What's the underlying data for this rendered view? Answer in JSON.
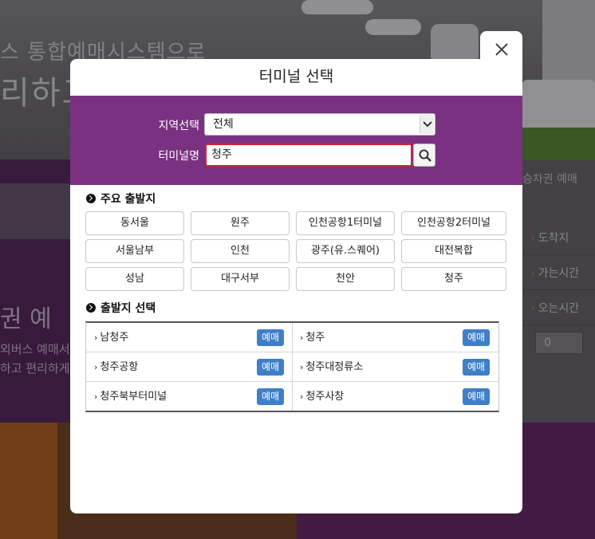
{
  "background": {
    "hero_line1": "스 통합예매시스템으로",
    "hero_line2": "리하고",
    "left_big": "권  예",
    "left_small_1": "외버스 예매서",
    "left_small_2": "하고 편리하게",
    "right_tab": "승차권 예매",
    "right_rows": [
      "도착지",
      "가는시간",
      "오는시간"
    ],
    "right_select_value": "0"
  },
  "modal": {
    "title": "터미널 선택",
    "region_label": "지역선택",
    "region_value": "전체",
    "name_label": "터미널명",
    "name_value": "청주",
    "major_heading": "주요 출발지",
    "major_terminals": [
      "동서울",
      "원주",
      "인천공항1터미널",
      "인천공항2터미널",
      "서울남부",
      "인천",
      "광주(유.스퀘어)",
      "대전복합",
      "성남",
      "대구서부",
      "천안",
      "청주"
    ],
    "depart_heading": "출발지 선택",
    "book_label": "예매",
    "departures": [
      "남청주",
      "청주",
      "청주공항",
      "청주대정류소",
      "청주북부터미널",
      "청주사창"
    ]
  },
  "colors": {
    "panel_purple": "#7a3181",
    "input_border_red": "#d2232a",
    "book_blue": "#3f7fc7"
  },
  "icons": [
    "close-icon",
    "search-icon",
    "chevron-down-icon",
    "circle-arrow-icon",
    "chevron-right-icon"
  ]
}
